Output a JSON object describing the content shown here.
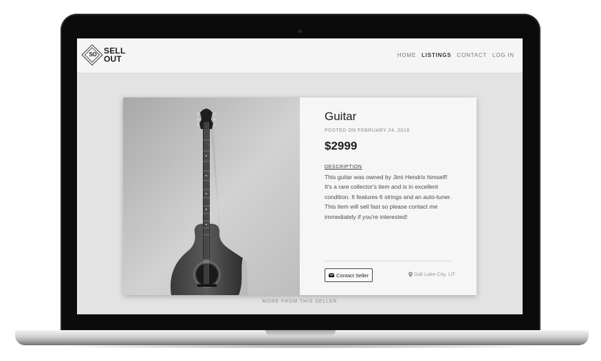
{
  "brand": {
    "mark": "SO",
    "line1": "SELL",
    "line2": "OUT"
  },
  "nav": {
    "home": "HOME",
    "listings": "LISTINGS",
    "contact": "CONTACT",
    "login": "LOG IN"
  },
  "listing": {
    "title": "Guitar",
    "posted": "POSTED ON FEBRUARY 24, 2018",
    "price": "$2999",
    "description_label": "DESCRIPTION",
    "description_lines": [
      "This guitar was owned by Jimi Hendrix himself!",
      "It's a rare collector's item and is in excellent",
      "condition. It features 6 strings and an auto-tuner.",
      "This item will sell fast so please contact me",
      "immediately if you're interested!"
    ],
    "contact_button": "Contact Seller",
    "location": "Salt Lake City, UT"
  },
  "more_from_seller": "MORE FROM THIS SELLER",
  "icons": {
    "logo": "diamond-logo-icon",
    "mail": "envelope-icon",
    "pin": "map-pin-icon"
  }
}
